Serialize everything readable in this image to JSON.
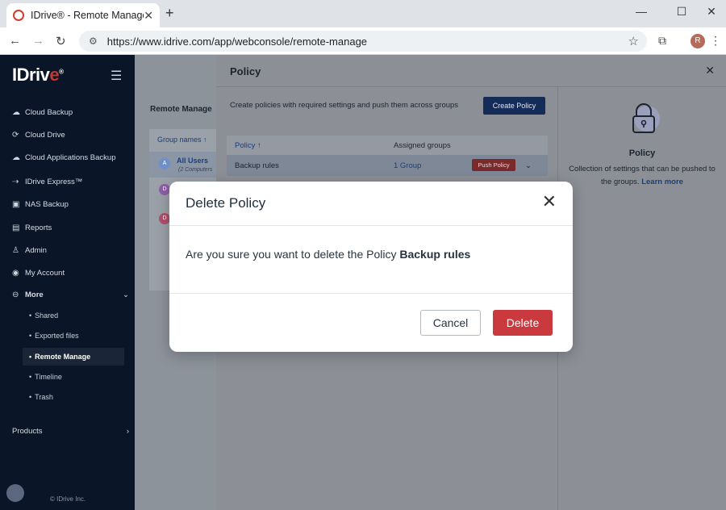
{
  "browser": {
    "tab_title": "IDrive® - Remote Manage",
    "tab_close": "✕",
    "new_tab": "+",
    "url": "https://www.idrive.com/app/webconsole/remote-manage",
    "profile_initial": "R",
    "window_controls": {
      "minimize": "—",
      "maximize": "☐",
      "close": "✕"
    }
  },
  "sidebar": {
    "logo_text": "IDriv",
    "logo_e": "e",
    "logo_mark": "®",
    "items": [
      {
        "label": "Cloud Backup",
        "icon": "cloud-backup-icon"
      },
      {
        "label": "Cloud Drive",
        "icon": "cloud-drive-icon"
      },
      {
        "label": "Cloud Applications Backup",
        "icon": "apps-backup-icon"
      },
      {
        "label": "IDrive Express™",
        "icon": "express-icon"
      },
      {
        "label": "NAS Backup",
        "icon": "nas-icon"
      },
      {
        "label": "Reports",
        "icon": "reports-icon"
      },
      {
        "label": "Admin",
        "icon": "admin-icon"
      },
      {
        "label": "My Account",
        "icon": "account-icon"
      },
      {
        "label": "More",
        "icon": "more-icon"
      }
    ],
    "sub_items": [
      "Shared",
      "Exported files",
      "Remote Manage",
      "Timeline",
      "Trash"
    ],
    "active_sub": "Remote Manage",
    "products": "Products",
    "copyright": "© IDrive Inc."
  },
  "main": {
    "title": "Remote Manage",
    "group_header": "Group names ↑",
    "groups": [
      {
        "initial": "A",
        "name": "All Users",
        "count": "(2 Computers"
      },
      {
        "initial": "D"
      },
      {
        "initial": "D"
      }
    ]
  },
  "drawer": {
    "title": "Policy",
    "description": "Create policies with required settings and push them across groups",
    "create_button": "Create Policy",
    "table": {
      "headers": [
        "Policy ↑",
        "Assigned groups"
      ],
      "rows": [
        {
          "policy": "Backup rules",
          "groups": "1 Group",
          "action": "Push Policy"
        }
      ]
    },
    "info": {
      "title": "Policy",
      "text": "Collection of settings that can be pushed to the groups.",
      "link": "Learn more"
    }
  },
  "modal": {
    "title": "Delete Policy",
    "message": "Are you sure you want to delete the Policy",
    "policy_name": "Backup rules",
    "cancel": "Cancel",
    "delete": "Delete"
  },
  "colors": {
    "sidebar_bg": "#0a1627",
    "primary": "#162c58",
    "danger": "#c9393d",
    "brand_red": "#d23b2e"
  }
}
